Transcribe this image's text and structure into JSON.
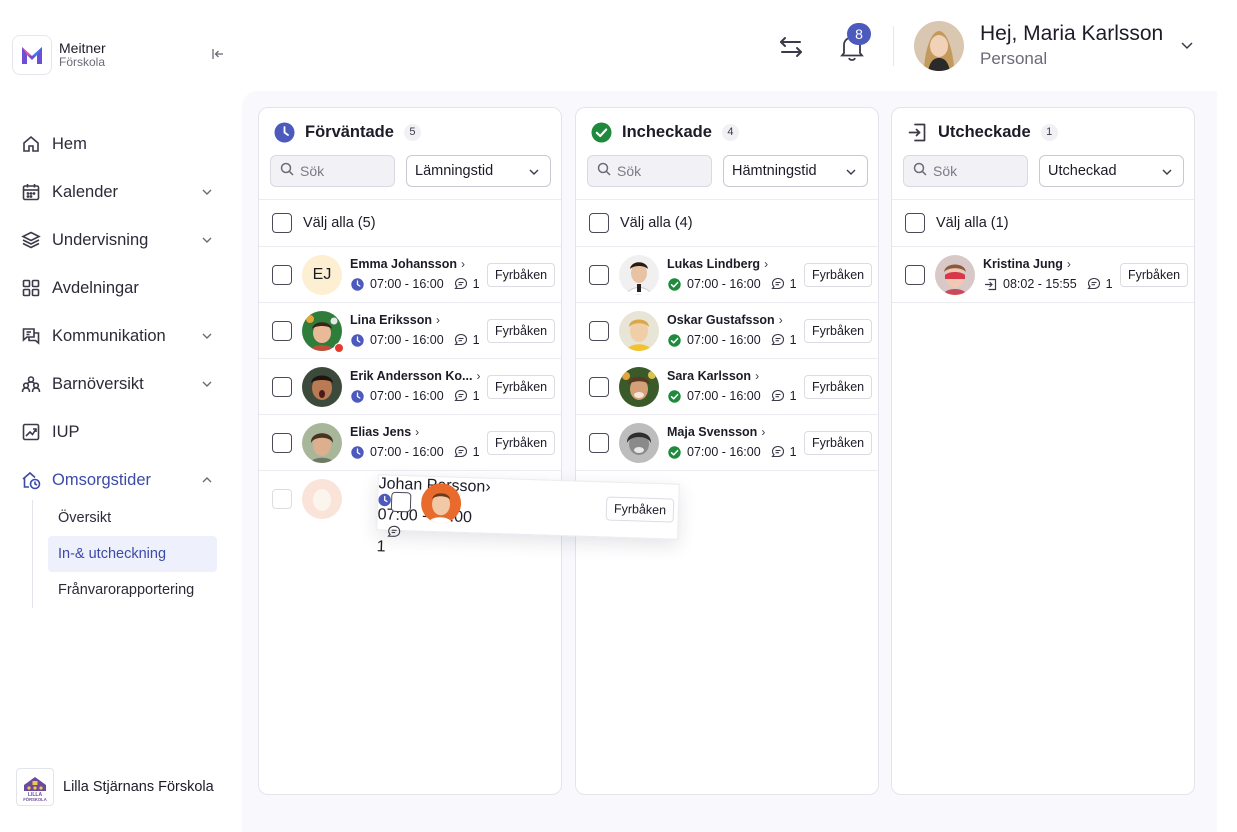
{
  "brand": {
    "name": "Meitner",
    "sub": "Förskola"
  },
  "nav": {
    "items": [
      {
        "label": "Hem"
      },
      {
        "label": "Kalender"
      },
      {
        "label": "Undervisning"
      },
      {
        "label": "Avdelningar"
      },
      {
        "label": "Kommunikation"
      },
      {
        "label": "Barnöversikt"
      },
      {
        "label": "IUP"
      },
      {
        "label": "Omsorgstider"
      }
    ],
    "sub_items": [
      {
        "label": "Översikt"
      },
      {
        "label": "In-& utcheckning"
      },
      {
        "label": "Frånvarorapportering"
      }
    ]
  },
  "school": {
    "name": "Lilla Stjärnans Förskola",
    "logo_text_1": "LILLA",
    "logo_text_2": "FÖRSKOLA"
  },
  "header": {
    "notification_count": "8",
    "greeting": "Hej, Maria Karlsson",
    "role": "Personal"
  },
  "colors": {
    "accent": "#4c5abd",
    "checked": "#1f8a3e",
    "danger": "#e23a2e"
  },
  "columns": [
    {
      "title": "Förväntade",
      "count": "5",
      "icon": "clock-icon",
      "search_placeholder": "Sök",
      "sort": "Lämningstid",
      "select_all": "Välj alla (5)",
      "rows": [
        {
          "name": "Emma Johansson",
          "initials": "EJ",
          "time": "07:00 - 16:00",
          "comments": "1",
          "tag": "Fyrbåken"
        },
        {
          "name": "Lina Eriksson",
          "time": "07:00 - 16:00",
          "comments": "1",
          "tag": "Fyrbåken"
        },
        {
          "name": "Erik Andersson Ko...",
          "time": "07:00 - 16:00",
          "comments": "1",
          "tag": "Fyrbåken"
        },
        {
          "name": "Elias Jens",
          "time": "07:00 - 16:00",
          "comments": "1",
          "tag": "Fyrbåken"
        },
        {
          "name": "Johan Persson",
          "time": "07:00 - 16:00",
          "comments": "1",
          "tag": "Fyrbåken"
        }
      ]
    },
    {
      "title": "Incheckade",
      "count": "4",
      "icon": "check-circle-icon",
      "search_placeholder": "Sök",
      "sort": "Hämtningstid",
      "select_all": "Välj alla (4)",
      "rows": [
        {
          "name": "Lukas Lindberg",
          "time": "07:00 - 16:00",
          "comments": "1",
          "tag": "Fyrbåken"
        },
        {
          "name": "Oskar Gustafsson",
          "time": "07:00 - 16:00",
          "comments": "1",
          "tag": "Fyrbåken"
        },
        {
          "name": "Sara Karlsson",
          "time": "07:00 - 16:00",
          "comments": "1",
          "tag": "Fyrbåken"
        },
        {
          "name": "Maja Svensson",
          "time": "07:00 - 16:00",
          "comments": "1",
          "tag": "Fyrbåken"
        }
      ]
    },
    {
      "title": "Utcheckade",
      "count": "1",
      "icon": "sign-out-icon",
      "search_placeholder": "Sök",
      "sort": "Utcheckad",
      "select_all": "Välj alla (1)",
      "rows": [
        {
          "name": "Kristina Jung",
          "time": "08:02 - 15:55",
          "comments": "1",
          "tag": "Fyrbåken"
        }
      ]
    }
  ]
}
